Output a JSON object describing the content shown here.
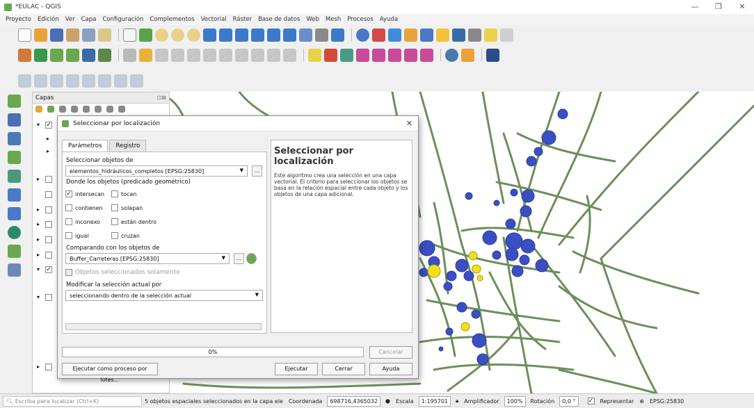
{
  "window": {
    "title": "*EULAC - QGIS",
    "controls": [
      "—",
      "❐",
      "✕"
    ]
  },
  "menubar": [
    "Proyecto",
    "Edición",
    "Ver",
    "Capa",
    "Configuración",
    "Complementos",
    "Vectorial",
    "Ráster",
    "Base de datos",
    "Web",
    "Mesh",
    "Procesos",
    "Ayuda"
  ],
  "layers_panel": {
    "title": "Capas",
    "dock_icons": "⊡⊠"
  },
  "dialog": {
    "title": "Seleccionar por localización",
    "close": "✕",
    "tabs": [
      "Parámetros",
      "Registro"
    ],
    "select_from_label": "Seleccionar objetos de",
    "select_from_value": "elementos_hidráulicos_completos [EPSG:25830]",
    "predicate_label": "Donde los objetos (predicado geométrico)",
    "predicates": [
      {
        "label": "intersecan",
        "checked": true
      },
      {
        "label": "tocan",
        "checked": false
      },
      {
        "label": "contienen",
        "checked": false
      },
      {
        "label": "solapan",
        "checked": false
      },
      {
        "label": "inconexo",
        "checked": false
      },
      {
        "label": "están dentro",
        "checked": false
      },
      {
        "label": "igual",
        "checked": false
      },
      {
        "label": "cruzan",
        "checked": false
      }
    ],
    "compare_label": "Comparando con los objetos de",
    "compare_value": "Buffer_Carreteras [EPSG:25830]",
    "selected_only": "Objetos seleccionados solamente",
    "modify_label": "Modificar la selección actual por",
    "modify_value": "seleccionando dentro de la selección actual",
    "help_title": "Seleccionar por localización",
    "help_text": "Este algoritmo crea una selección en una capa vectorial. El criterio para seleccionar los objetos se basa en la relación espacial entre cada objeto y los objetos de una capa adicional.",
    "progress": "0%",
    "progress_value": 0,
    "buttons": {
      "cancel": "Cancelar",
      "batch": "Ejecutar como proceso por lotes...",
      "run": "Ejecutar",
      "close": "Cerrar",
      "help": "Ayuda"
    }
  },
  "statusbar": {
    "locate_placeholder": "Escriba para localizar (Ctrl+K)",
    "message": "5 objetos espaciales seleccionados en la capa ele",
    "coord_label": "Coordenada",
    "coord_value": "698716,4365032",
    "scale_label": "Escala",
    "scale_value": "1:195701",
    "magnifier_label": "Amplificador",
    "magnifier_value": "100%",
    "rotation_label": "Rotación",
    "rotation_value": "0,0 °",
    "render_label": "Representar",
    "crs": "EPSG:25830"
  },
  "colors": {
    "roads": "#6b8f5a",
    "features": "#3b4fc4",
    "selected": "#f2e11a"
  }
}
